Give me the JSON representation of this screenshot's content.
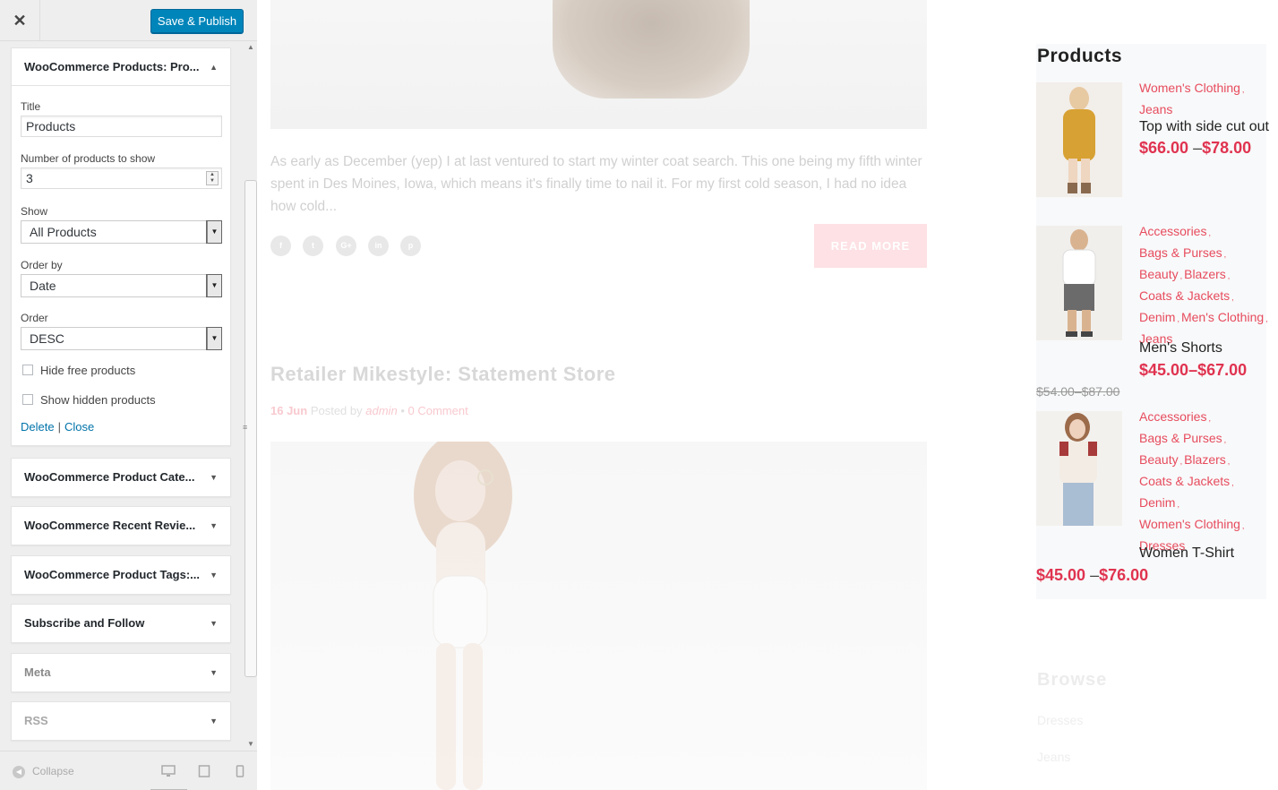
{
  "topbar": {
    "close_glyph": "✕",
    "save_label": "Save & Publish"
  },
  "widget_products": {
    "title": "WooCommerce Products: Pro...",
    "arrow_glyph": "▲",
    "fields": {
      "title_label": "Title",
      "title_value": "Products",
      "count_label": "Number of products to show",
      "count_value": "3",
      "show_label": "Show",
      "show_value": "All Products",
      "orderby_label": "Order by",
      "orderby_value": "Date",
      "order_label": "Order",
      "order_value": "DESC",
      "hide_free_label": "Hide free products",
      "show_hidden_label": "Show hidden products"
    },
    "links": {
      "delete": "Delete",
      "separator": "|",
      "close": "Close"
    }
  },
  "widgets": [
    {
      "title": "WooCommerce Product Cate..."
    },
    {
      "title": "WooCommerce Recent Revie..."
    },
    {
      "title": "WooCommerce Product Tags:..."
    },
    {
      "title": "Subscribe and Follow"
    },
    {
      "title": "Meta"
    },
    {
      "title": "RSS"
    }
  ],
  "collapsed_arrow_glyph": "▼",
  "footer": {
    "collapse_label": "Collapse",
    "collapse_icon": "arrow-left-circle-icon",
    "devices": [
      "desktop-icon",
      "tablet-icon",
      "mobile-icon"
    ]
  },
  "preview": {
    "excerpt": "As early as December (yep) I at last ventured to start my winter coat search. This one being my fifth winter spent in Des Moines, Iowa, which means it's finally time to nail it. For my first cold season, I had no idea how cold...",
    "social": [
      "f",
      "t",
      "G+",
      "in",
      "p"
    ],
    "read_more": "READ MORE",
    "post_title": "Retailer Mikestyle: Statement Store",
    "post_meta": {
      "date": "16 Jun",
      "posted_by": "Posted by",
      "author": "admin",
      "bullet": "•",
      "comments": "0 Comment"
    },
    "products_widget": {
      "title": "Products",
      "items": [
        {
          "categories": [
            "Women's Clothing",
            "Jeans"
          ],
          "name": "Top with side cut out",
          "price_low": "$66.00",
          "dash": "–",
          "price_high": "$78.00"
        },
        {
          "categories": [
            "Accessories",
            "Bags & Purses",
            "Beauty",
            "Blazers",
            "Coats & Jackets",
            "Denim",
            "Men's Clothing",
            "Jeans"
          ],
          "name": "Men's Shorts",
          "price_low": "$45.00",
          "dash": "–",
          "price_high": "$67.00",
          "old_price": "$54.00–$87.00"
        },
        {
          "categories": [
            "Accessories",
            "Bags & Purses",
            "Beauty",
            "Blazers",
            "Coats & Jackets",
            "Denim",
            "Women's Clothing",
            "Dresses"
          ],
          "name": "Women T-Shirt",
          "price_low": "$45.00",
          "dash": "–",
          "price_high": "$76.00"
        }
      ]
    },
    "browse": {
      "title": "Browse",
      "items": [
        "Dresses",
        "Jeans"
      ]
    }
  },
  "colors": {
    "primary_button": "#0085ba",
    "link": "#0073aa",
    "accent_red": "#e03350",
    "category_red": "#e74c5e"
  }
}
